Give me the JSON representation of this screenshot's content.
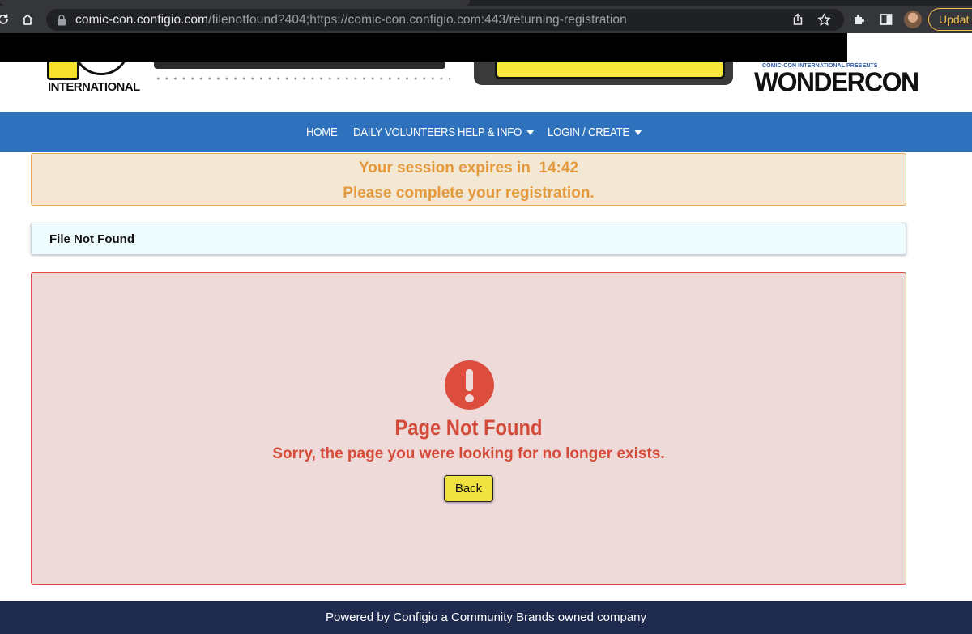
{
  "browser": {
    "url_host": "comic-con.configio.com",
    "url_path": "/filenotfound?404;https://comic-con.configio.com:443/returning-registration",
    "update_label": "Updat"
  },
  "header": {
    "left_logo_text": "INTERNATIONAL",
    "right_logo_small": "COMIC-CON INTERNATIONAL PRESENTS",
    "right_logo_big": "WONDERCON"
  },
  "nav": {
    "items": [
      {
        "label": "HOME"
      },
      {
        "label": "DAILY VOLUNTEERS"
      },
      {
        "label": "HELP & INFO"
      },
      {
        "label": "LOGIN / CREATE"
      }
    ]
  },
  "session": {
    "line1": "Your session expires in  14:42",
    "line2": "Please complete your registration."
  },
  "panel": {
    "heading": "File Not Found"
  },
  "error": {
    "title": "Page Not Found",
    "message": "Sorry, the page you were looking for no longer exists.",
    "back_label": "Back"
  },
  "footer": {
    "text": "Powered by Configio a Community Brands owned company"
  },
  "colors": {
    "nav_bg": "#2e72bd",
    "alert_text": "#e49a3c",
    "error": "#d54b3a",
    "footer_bg": "#1f2a4f",
    "button_bg": "#f0e240"
  }
}
